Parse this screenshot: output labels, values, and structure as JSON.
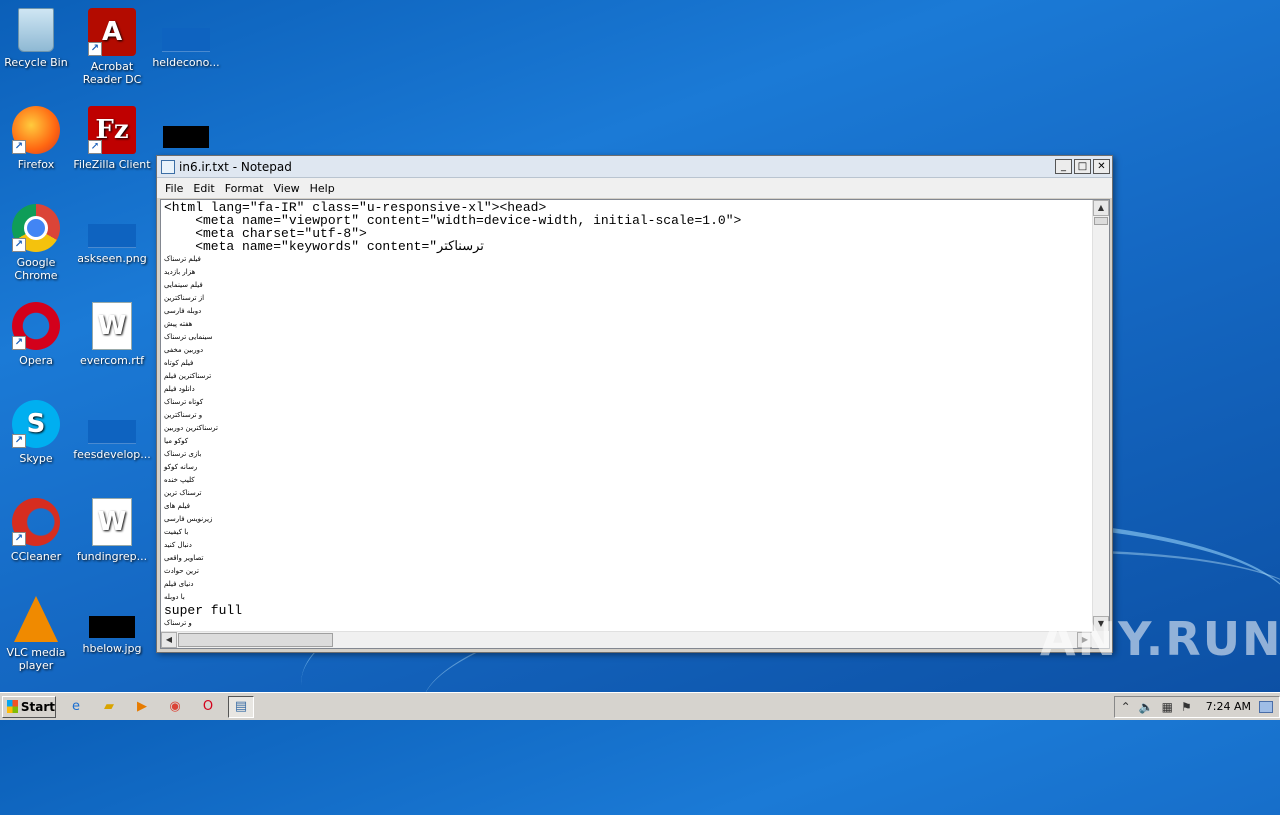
{
  "desktop": {
    "icons": [
      {
        "label": "Recycle Bin"
      },
      {
        "label": "Acrobat Reader DC"
      },
      {
        "label": "heldecono..."
      },
      {
        "label": "Firefox"
      },
      {
        "label": "FileZilla Client"
      },
      {
        "label": "Google Chrome"
      },
      {
        "label": "askseen.png"
      },
      {
        "label": "Opera"
      },
      {
        "label": "evercom.rtf"
      },
      {
        "label": "Skype"
      },
      {
        "label": "feesdevelop..."
      },
      {
        "label": "CCleaner"
      },
      {
        "label": "fundingrep..."
      },
      {
        "label": "VLC media player"
      },
      {
        "label": "hbelow.jpg"
      }
    ]
  },
  "notepad": {
    "title": "in6.ir.txt - Notepad",
    "menu": [
      "File",
      "Edit",
      "Format",
      "View",
      "Help"
    ],
    "lines": [
      "<html lang=\"fa-IR\" class=\"u-responsive-xl\"><head>",
      "    <meta name=\"viewport\" content=\"width=device-width, initial-scale=1.0\">",
      "    <meta charset=\"utf-8\">",
      "    <meta name=\"keywords\" content=\"ترسناکتر"
    ],
    "fa_lines": [
      "فیلم ترسناک",
      "هزار بازدید",
      "فیلم سینمایی",
      "از ترسناکترین",
      "دوبله فارسی",
      "هفته پیش",
      "سینمایی ترسناک",
      "دوربین مخفی",
      "فیلم کوتاه",
      "ترسناکترین فیلم",
      "دانلود فیلم",
      "کوتاه ترسناک",
      "و ترسناکترین",
      "ترسناکترین دوربین",
      "کوکو میا",
      "بازی ترسناک",
      "رسانه کوکو",
      "کلیپ خنده",
      "ترسناک ترین",
      "فیلم های",
      "زیرنویس فارسی",
      "با کیفیت",
      "دنبال کنید",
      "تصاویر واقعی",
      "ترین حوادث",
      "دنیای فیلم",
      "با دوبله"
    ],
    "tail_mono": "super full",
    "tail_fa": "و ترسناک"
  },
  "watermark": "ANY.RUN",
  "taskbar": {
    "start_label": "Start",
    "clock": "7:24 AM"
  }
}
